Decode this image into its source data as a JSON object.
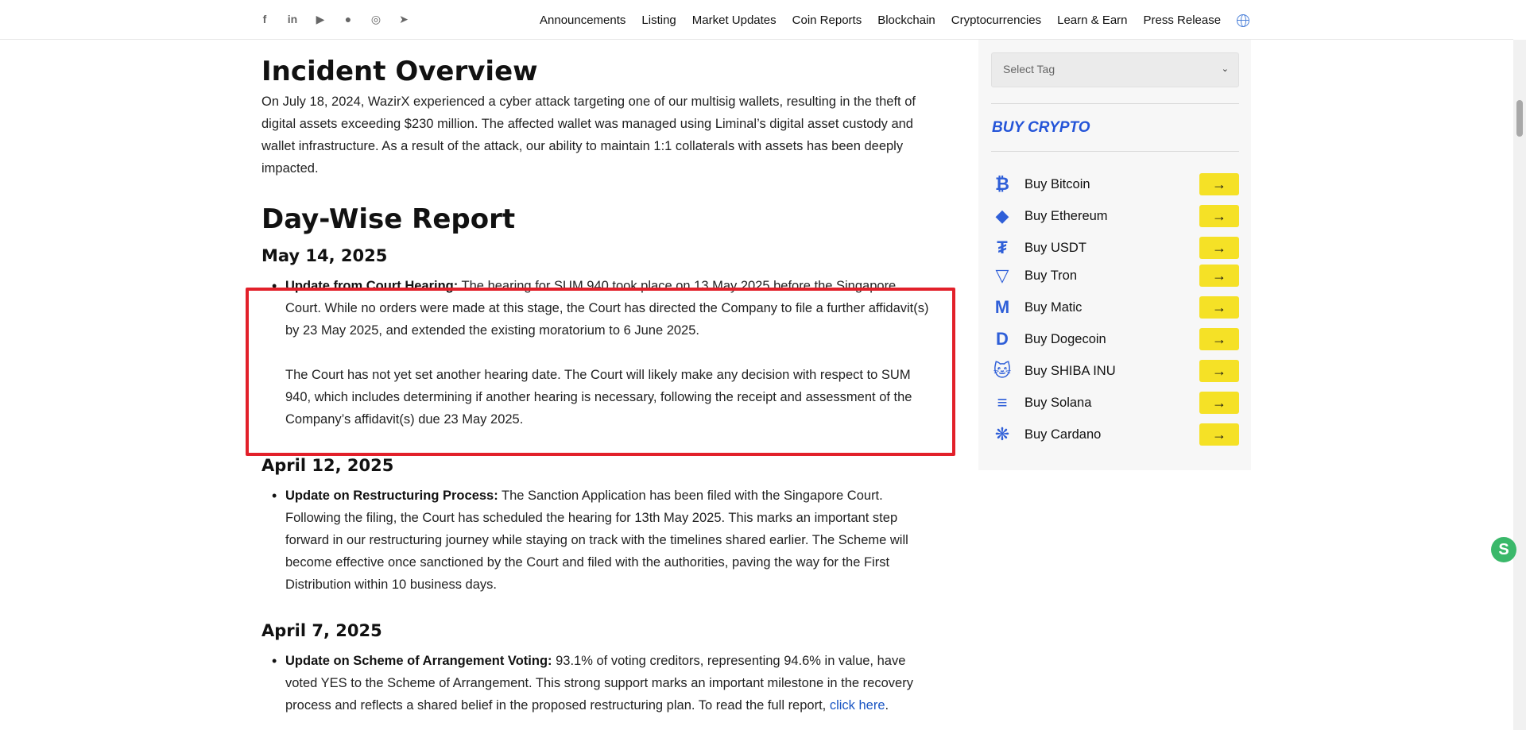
{
  "topbar": {
    "social_icons": [
      "facebook-icon",
      "linkedin-icon",
      "youtube-icon",
      "reddit-icon",
      "instagram-icon",
      "telegram-icon"
    ],
    "nav": [
      "Announcements",
      "Listing",
      "Market Updates",
      "Coin Reports",
      "Blockchain",
      "Cryptocurrencies",
      "Learn & Earn",
      "Press Release"
    ]
  },
  "article": {
    "incident_title": "Incident Overview",
    "incident_text": "On July 18, 2024, WazirX experienced a cyber attack targeting one of our multisig wallets, resulting in the theft of digital assets exceeding $230 million. The affected wallet was managed using Liminal’s digital asset custody and wallet infrastructure. As a result of the attack, our ability to maintain 1:1 collaterals with assets has been deeply impacted.",
    "report_title": "Day-Wise Report",
    "entries": [
      {
        "date": "May 14, 2025",
        "heading": "Update from Court Hearing:",
        "text": " The hearing for SUM 940 took place on 13 May 2025 before the Singapore Court. While no orders were made at this stage, the Court has directed the Company to file a further affidavit(s) by 23 May 2025, and extended the existing moratorium to 6 June 2025.",
        "text2": "The Court has not yet set another hearing date. The Court will likely make any decision with respect to SUM 940, which includes determining if another hearing is necessary, following the receipt and assessment of the Company’s affidavit(s) due 23 May 2025."
      },
      {
        "date": "April 12, 2025",
        "heading": "Update on Restructuring Process:",
        "text": " The Sanction Application has been filed with the Singapore Court. Following the filing, the Court has scheduled the hearing for 13th May 2025. This marks an important step forward in our restructuring journey while staying on track with the timelines shared earlier. The Scheme will become effective once sanctioned by the Court and filed with the authorities, paving the way for the First Distribution within 10 business days."
      },
      {
        "date": "April 7, 2025",
        "heading": "Update on Scheme of Arrangement Voting:",
        "text": " 93.1% of voting creditors, representing 94.6% in value, have voted YES to the Scheme of Arrangement. This strong support marks an important milestone in the recovery process and reflects a shared belief in the proposed restructuring plan. To read the full report, ",
        "link": "click here",
        "tail": "."
      }
    ]
  },
  "sidebar": {
    "select_tag": "Select Tag",
    "buy_title": "BUY CRYPTO",
    "coins": [
      {
        "label": "Buy Bitcoin",
        "icon": "bitcoin-icon",
        "glyph": "₿"
      },
      {
        "label": "Buy Ethereum",
        "icon": "ethereum-icon",
        "glyph": "◆"
      },
      {
        "label": "Buy USDT",
        "icon": "tether-icon",
        "glyph": "₮"
      },
      {
        "label": "Buy Tron",
        "icon": "tron-icon",
        "glyph": "▽"
      },
      {
        "label": "Buy Matic",
        "icon": "matic-icon",
        "glyph": "M"
      },
      {
        "label": "Buy Dogecoin",
        "icon": "dogecoin-icon",
        "glyph": "D"
      },
      {
        "label": "Buy SHIBA INU",
        "icon": "shiba-icon",
        "glyph": "🐱"
      },
      {
        "label": "Buy Solana",
        "icon": "solana-icon",
        "glyph": "≡"
      },
      {
        "label": "Buy Cardano",
        "icon": "cardano-icon",
        "glyph": "❋"
      }
    ],
    "arrow": "→"
  },
  "colors": {
    "accent": "#2454d8",
    "button": "#f5e126",
    "highlight": "#e2202a"
  }
}
